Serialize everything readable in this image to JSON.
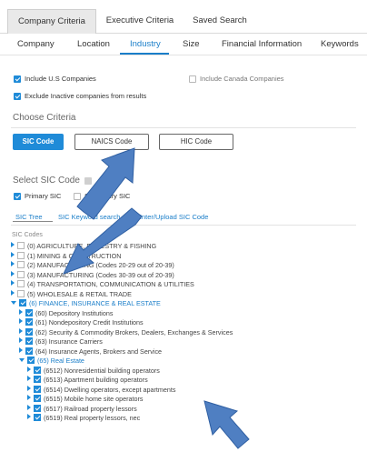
{
  "top_tabs": [
    "Company Criteria",
    "Executive Criteria",
    "Saved Search"
  ],
  "sub_tabs": [
    "Company",
    "Location",
    "Industry",
    "Size",
    "Financial Information",
    "Keywords"
  ],
  "options": {
    "include_us": "Include U.S Companies",
    "include_canada": "Include Canada Companies",
    "exclude_inactive": "Exclude Inactive companies from results"
  },
  "choose_criteria": {
    "title": "Choose Criteria",
    "buttons": [
      "SIC Code",
      "NAICS Code",
      "HIC Code"
    ]
  },
  "select_sic": {
    "title": "Select SIC Code",
    "primary": "Primary SIC",
    "secondary": "Secondary SIC"
  },
  "sic_links": [
    "SIC Tree",
    "SIC Keyword search",
    "Enter/Upload SIC Code"
  ],
  "sic_codes_label": "SIC Codes",
  "tree": [
    {
      "label": "(0) AGRICULTURE, FORESTRY & FISHING",
      "level": 0,
      "expanded": false,
      "checked": false
    },
    {
      "label": "(1) MINING & CONSTRUCTION",
      "level": 0,
      "expanded": false,
      "checked": false
    },
    {
      "label": "(2) MANUFACTURING (Codes 20-29 out of 20-39)",
      "level": 0,
      "expanded": false,
      "checked": false
    },
    {
      "label": "(3) MANUFACTURING (Codes 30-39 out of 20-39)",
      "level": 0,
      "expanded": false,
      "checked": false
    },
    {
      "label": "(4) TRANSPORTATION, COMMUNICATION & UTILITIES",
      "level": 0,
      "expanded": false,
      "checked": false
    },
    {
      "label": "(5) WHOLESALE & RETAIL TRADE",
      "level": 0,
      "expanded": false,
      "checked": false
    },
    {
      "label": "(6) FINANCE, INSURANCE & REAL ESTATE",
      "level": 0,
      "expanded": true,
      "checked": true
    },
    {
      "label": "(60) Depository Institutions",
      "level": 1,
      "expanded": false,
      "checked": true
    },
    {
      "label": "(61) Nondepository Credit Institutions",
      "level": 1,
      "expanded": false,
      "checked": true
    },
    {
      "label": "(62) Security & Commodity Brokers, Dealers, Exchanges & Services",
      "level": 1,
      "expanded": false,
      "checked": true
    },
    {
      "label": "(63) Insurance Carriers",
      "level": 1,
      "expanded": false,
      "checked": true
    },
    {
      "label": "(64) Insurance Agents, Brokers and Service",
      "level": 1,
      "expanded": false,
      "checked": true
    },
    {
      "label": "(65) Real Estate",
      "level": 1,
      "expanded": true,
      "checked": true
    },
    {
      "label": "(6512) Nonresidential building operators",
      "level": 2,
      "expanded": false,
      "checked": true
    },
    {
      "label": "(6513) Apartment building operators",
      "level": 2,
      "expanded": false,
      "checked": true
    },
    {
      "label": "(6514) Dwelling operators, except apartments",
      "level": 2,
      "expanded": false,
      "checked": true
    },
    {
      "label": "(6515) Mobile home site operators",
      "level": 2,
      "expanded": false,
      "checked": true
    },
    {
      "label": "(6517) Railroad property lessors",
      "level": 2,
      "expanded": false,
      "checked": true
    },
    {
      "label": "(6519) Real property lessors, nec",
      "level": 2,
      "expanded": false,
      "checked": true
    }
  ],
  "colors": {
    "accent": "#1f8bd8",
    "arrow": "#4f7fc2"
  }
}
